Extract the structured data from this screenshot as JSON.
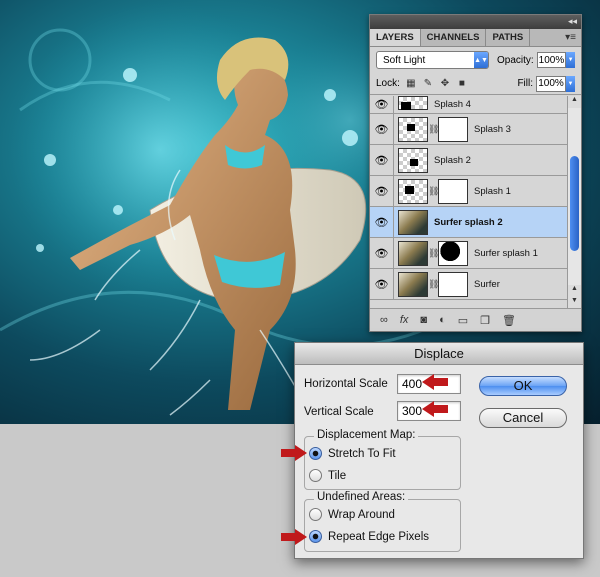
{
  "layers_panel": {
    "tabs": [
      "LAYERS",
      "CHANNELS",
      "PATHS"
    ],
    "blend_mode": "Soft Light",
    "opacity_label": "Opacity:",
    "opacity_value": "100%",
    "lock_label": "Lock:",
    "fill_label": "Fill:",
    "fill_value": "100%",
    "layers": [
      {
        "name": "Splash 4",
        "selected": false
      },
      {
        "name": "Splash 3",
        "selected": false
      },
      {
        "name": "Splash 2",
        "selected": false
      },
      {
        "name": "Splash 1",
        "selected": false
      },
      {
        "name": "Surfer splash 2",
        "selected": true
      },
      {
        "name": "Surfer splash 1",
        "selected": false
      },
      {
        "name": "Surfer",
        "selected": false
      }
    ],
    "footer_icons": [
      "link-icon",
      "fx-icon",
      "mask-icon",
      "adjustment-icon",
      "group-folder-icon",
      "new-layer-icon",
      "trash-icon"
    ],
    "selected_color": "#b6d3f6"
  },
  "displace_dialog": {
    "title": "Displace",
    "horizontal_scale_label": "Horizontal Scale",
    "horizontal_scale_value": "400",
    "vertical_scale_label": "Vertical Scale",
    "vertical_scale_value": "300",
    "ok_label": "OK",
    "cancel_label": "Cancel",
    "displacement_map_title": "Displacement Map:",
    "stretch_to_fit_label": "Stretch To Fit",
    "tile_label": "Tile",
    "undefined_areas_title": "Undefined Areas:",
    "wrap_around_label": "Wrap Around",
    "repeat_edge_pixels_label": "Repeat Edge Pixels",
    "selected_displacement": "Stretch To Fit",
    "selected_undefined": "Repeat Edge Pixels"
  },
  "annotation_color": "#c0191b"
}
